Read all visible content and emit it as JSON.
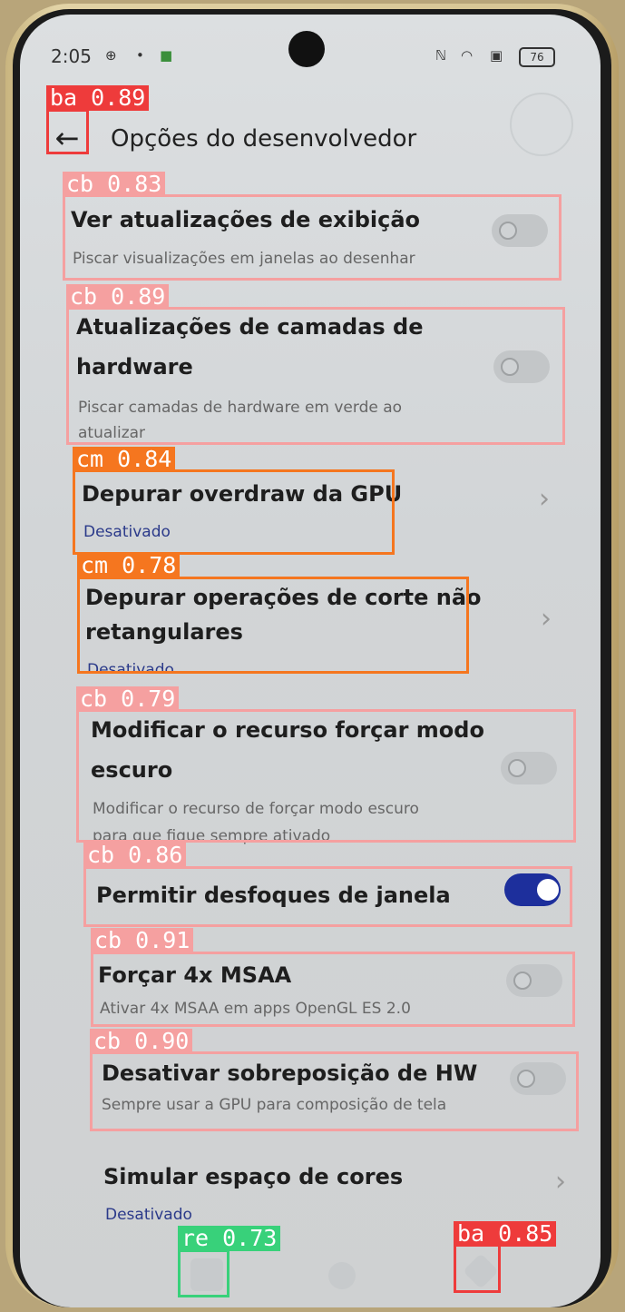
{
  "status_bar": {
    "time": "2:05",
    "battery": "76"
  },
  "header": {
    "title": "Opções do desenvolvedor"
  },
  "settings": [
    {
      "title": "Ver atualizações de exibição",
      "subtitle": "Piscar visualizações em janelas ao desenhar",
      "toggle": "off"
    },
    {
      "title_line1": "Atualizações de camadas de",
      "title_line2": "hardware",
      "subtitle_line1": "Piscar camadas de hardware em verde ao",
      "subtitle_line2": "atualizar",
      "toggle": "off"
    },
    {
      "title": "Depurar overdraw da GPU",
      "value": "Desativado"
    },
    {
      "title_line1": "Depurar operações de corte não",
      "title_line2": "retangulares",
      "value": "Desativado"
    },
    {
      "title_line1": "Modificar o recurso forçar modo",
      "title_line2": "escuro",
      "subtitle_line1": "Modificar o recurso de forçar modo escuro",
      "subtitle_line2": "para que fique sempre ativado",
      "toggle": "off"
    },
    {
      "title": "Permitir desfoques de janela",
      "toggle": "on"
    },
    {
      "title": "Forçar 4x MSAA",
      "subtitle": "Ativar 4x MSAA em apps OpenGL ES 2.0",
      "toggle": "off"
    },
    {
      "title": "Desativar sobreposição de HW",
      "subtitle": "Sempre usar a GPU para composição de tela",
      "toggle": "off"
    },
    {
      "title": "Simular espaço de cores",
      "value": "Desativado"
    }
  ],
  "annotations": [
    {
      "label": "ba 0.89",
      "color": "#ee3b3b"
    },
    {
      "label": "cb 0.83",
      "color": "#f5a0a0"
    },
    {
      "label": "cb 0.89",
      "color": "#f5a0a0"
    },
    {
      "label": "cm 0.84",
      "color": "#f5761f"
    },
    {
      "label": "cm 0.78",
      "color": "#f5761f"
    },
    {
      "label": "cb 0.79",
      "color": "#f5a0a0"
    },
    {
      "label": "cb 0.86",
      "color": "#f5a0a0"
    },
    {
      "label": "cb 0.91",
      "color": "#f5a0a0"
    },
    {
      "label": "cb 0.90",
      "color": "#f5a0a0"
    },
    {
      "label": "re 0.73",
      "color": "#38d17a"
    },
    {
      "label": "ba 0.85",
      "color": "#ee3b3b"
    }
  ]
}
